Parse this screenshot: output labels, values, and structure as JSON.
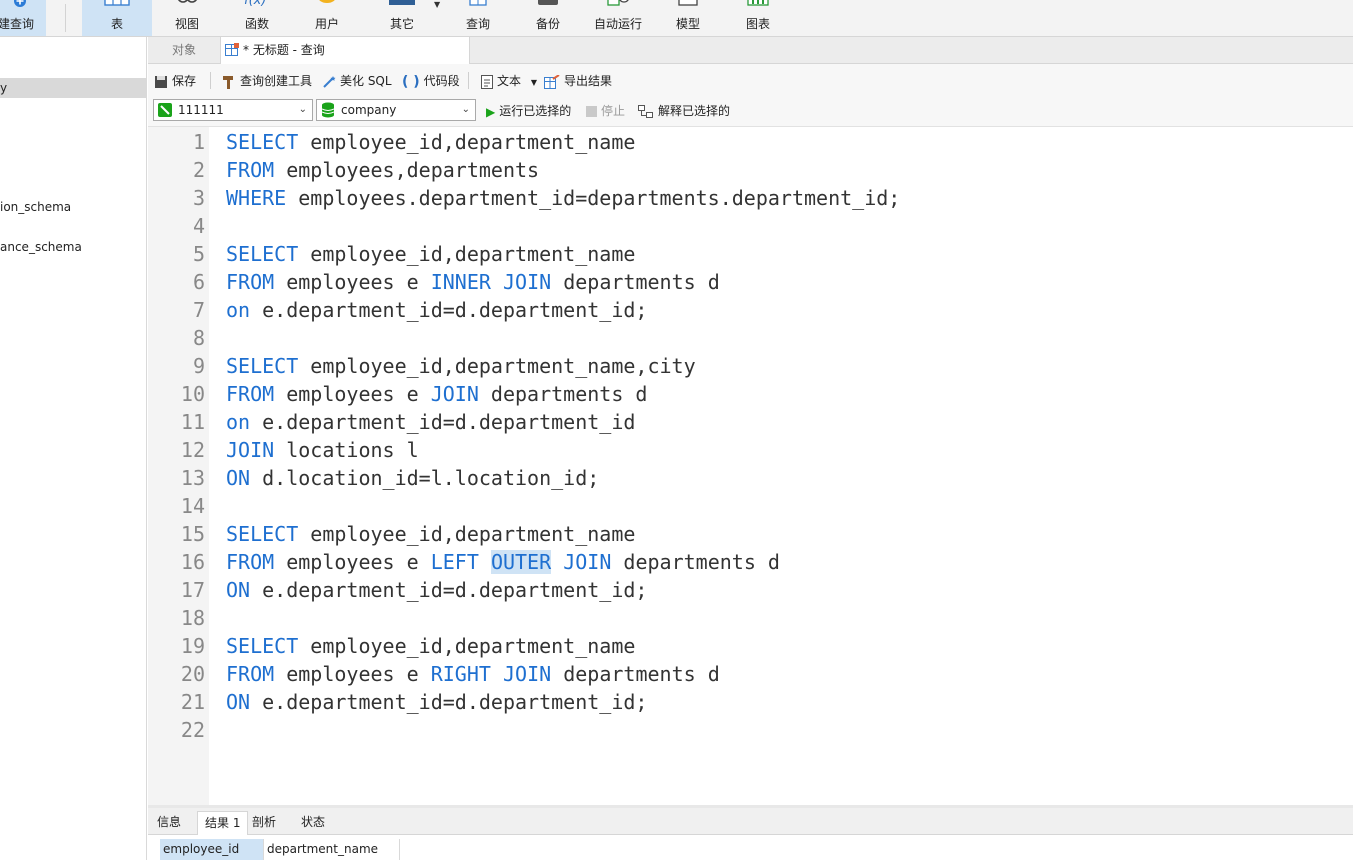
{
  "ribbon": {
    "new_query_label": "建查询",
    "buttons": [
      {
        "key": "table",
        "label": "表"
      },
      {
        "key": "view",
        "label": "视图"
      },
      {
        "key": "function",
        "label": "函数"
      },
      {
        "key": "user",
        "label": "用户"
      },
      {
        "key": "other",
        "label": "其它"
      },
      {
        "key": "query",
        "label": "查询"
      },
      {
        "key": "backup",
        "label": "备份"
      },
      {
        "key": "automation",
        "label": "自动运行"
      },
      {
        "key": "model",
        "label": "模型"
      },
      {
        "key": "chart",
        "label": "图表"
      }
    ],
    "partial_icon_text": "f(x)"
  },
  "sidebar": {
    "items": [
      {
        "label": "y",
        "selected": true
      },
      {
        "label": "ion_schema",
        "selected": false
      },
      {
        "label": "ance_schema",
        "selected": false
      }
    ]
  },
  "tabs": {
    "objects_label": "对象",
    "active_label": "* 无标题 - 查询"
  },
  "toolbar": {
    "save": "保存",
    "query_builder": "查询创建工具",
    "beautify_sql": "美化 SQL",
    "code_snippet": "代码段",
    "text": "文本",
    "export_results": "导出结果"
  },
  "connection": {
    "connection_name": "111111",
    "database": "company",
    "run_selected": "运行已选择的",
    "stop": "停止",
    "explain_selected": "解释已选择的"
  },
  "editor": {
    "line_numbers": [
      "1",
      "2",
      "3",
      "4",
      "5",
      "6",
      "7",
      "8",
      "9",
      "10",
      "11",
      "12",
      "13",
      "14",
      "15",
      "16",
      "17",
      "18",
      "19",
      "20",
      "21",
      "22"
    ],
    "lines": [
      [
        {
          "t": "SELECT",
          "k": true
        },
        {
          "t": " employee_id,department_name"
        }
      ],
      [
        {
          "t": "FROM",
          "k": true
        },
        {
          "t": " employees,departments"
        }
      ],
      [
        {
          "t": "WHERE",
          "k": true
        },
        {
          "t": " employees.department_id=departments.department_id;"
        }
      ],
      [],
      [
        {
          "t": "SELECT",
          "k": true
        },
        {
          "t": " employee_id,department_name"
        }
      ],
      [
        {
          "t": "FROM",
          "k": true
        },
        {
          "t": " employees e "
        },
        {
          "t": "INNER",
          "k": true
        },
        {
          "t": " "
        },
        {
          "t": "JOIN",
          "k": true
        },
        {
          "t": " departments d"
        }
      ],
      [
        {
          "t": "on",
          "k": true
        },
        {
          "t": " e.department_id=d.department_id;"
        }
      ],
      [],
      [
        {
          "t": "SELECT",
          "k": true
        },
        {
          "t": " employee_id,department_name,city"
        }
      ],
      [
        {
          "t": "FROM",
          "k": true
        },
        {
          "t": " employees e "
        },
        {
          "t": "JOIN",
          "k": true
        },
        {
          "t": " departments d"
        }
      ],
      [
        {
          "t": "on",
          "k": true
        },
        {
          "t": " e.department_id=d.department_id"
        }
      ],
      [
        {
          "t": "JOIN",
          "k": true
        },
        {
          "t": " locations l"
        }
      ],
      [
        {
          "t": "ON",
          "k": true
        },
        {
          "t": " d.location_id=l.location_id;"
        }
      ],
      [],
      [
        {
          "t": "SELECT",
          "k": true
        },
        {
          "t": " employee_id,department_name"
        }
      ],
      [
        {
          "t": "FROM",
          "k": true
        },
        {
          "t": " employees e "
        },
        {
          "t": "LEFT",
          "k": true
        },
        {
          "t": " "
        },
        {
          "t": "OUTER",
          "k": true,
          "h": true
        },
        {
          "t": " "
        },
        {
          "t": "JOIN",
          "k": true
        },
        {
          "t": " departments d"
        }
      ],
      [
        {
          "t": "ON",
          "k": true
        },
        {
          "t": " e.department_id=d.department_id;"
        }
      ],
      [],
      [
        {
          "t": "SELECT",
          "k": true
        },
        {
          "t": " employee_id,department_name"
        }
      ],
      [
        {
          "t": "FROM",
          "k": true
        },
        {
          "t": " employees e "
        },
        {
          "t": "RIGHT",
          "k": true
        },
        {
          "t": " "
        },
        {
          "t": "JOIN",
          "k": true
        },
        {
          "t": " departments d"
        }
      ],
      [
        {
          "t": "ON",
          "k": true
        },
        {
          "t": " e.department_id=d.department_id;"
        }
      ],
      []
    ]
  },
  "results": {
    "tabs": [
      {
        "label": "信息",
        "active": false
      },
      {
        "label": "结果 1",
        "active": true
      },
      {
        "label": "剖析",
        "active": false
      },
      {
        "label": "状态",
        "active": false
      }
    ],
    "columns": [
      "employee_id",
      "department_name"
    ]
  },
  "colors": {
    "keyword": "#1e6fd0",
    "selection": "#cfe3f5",
    "run_green": "#1aa31a"
  }
}
